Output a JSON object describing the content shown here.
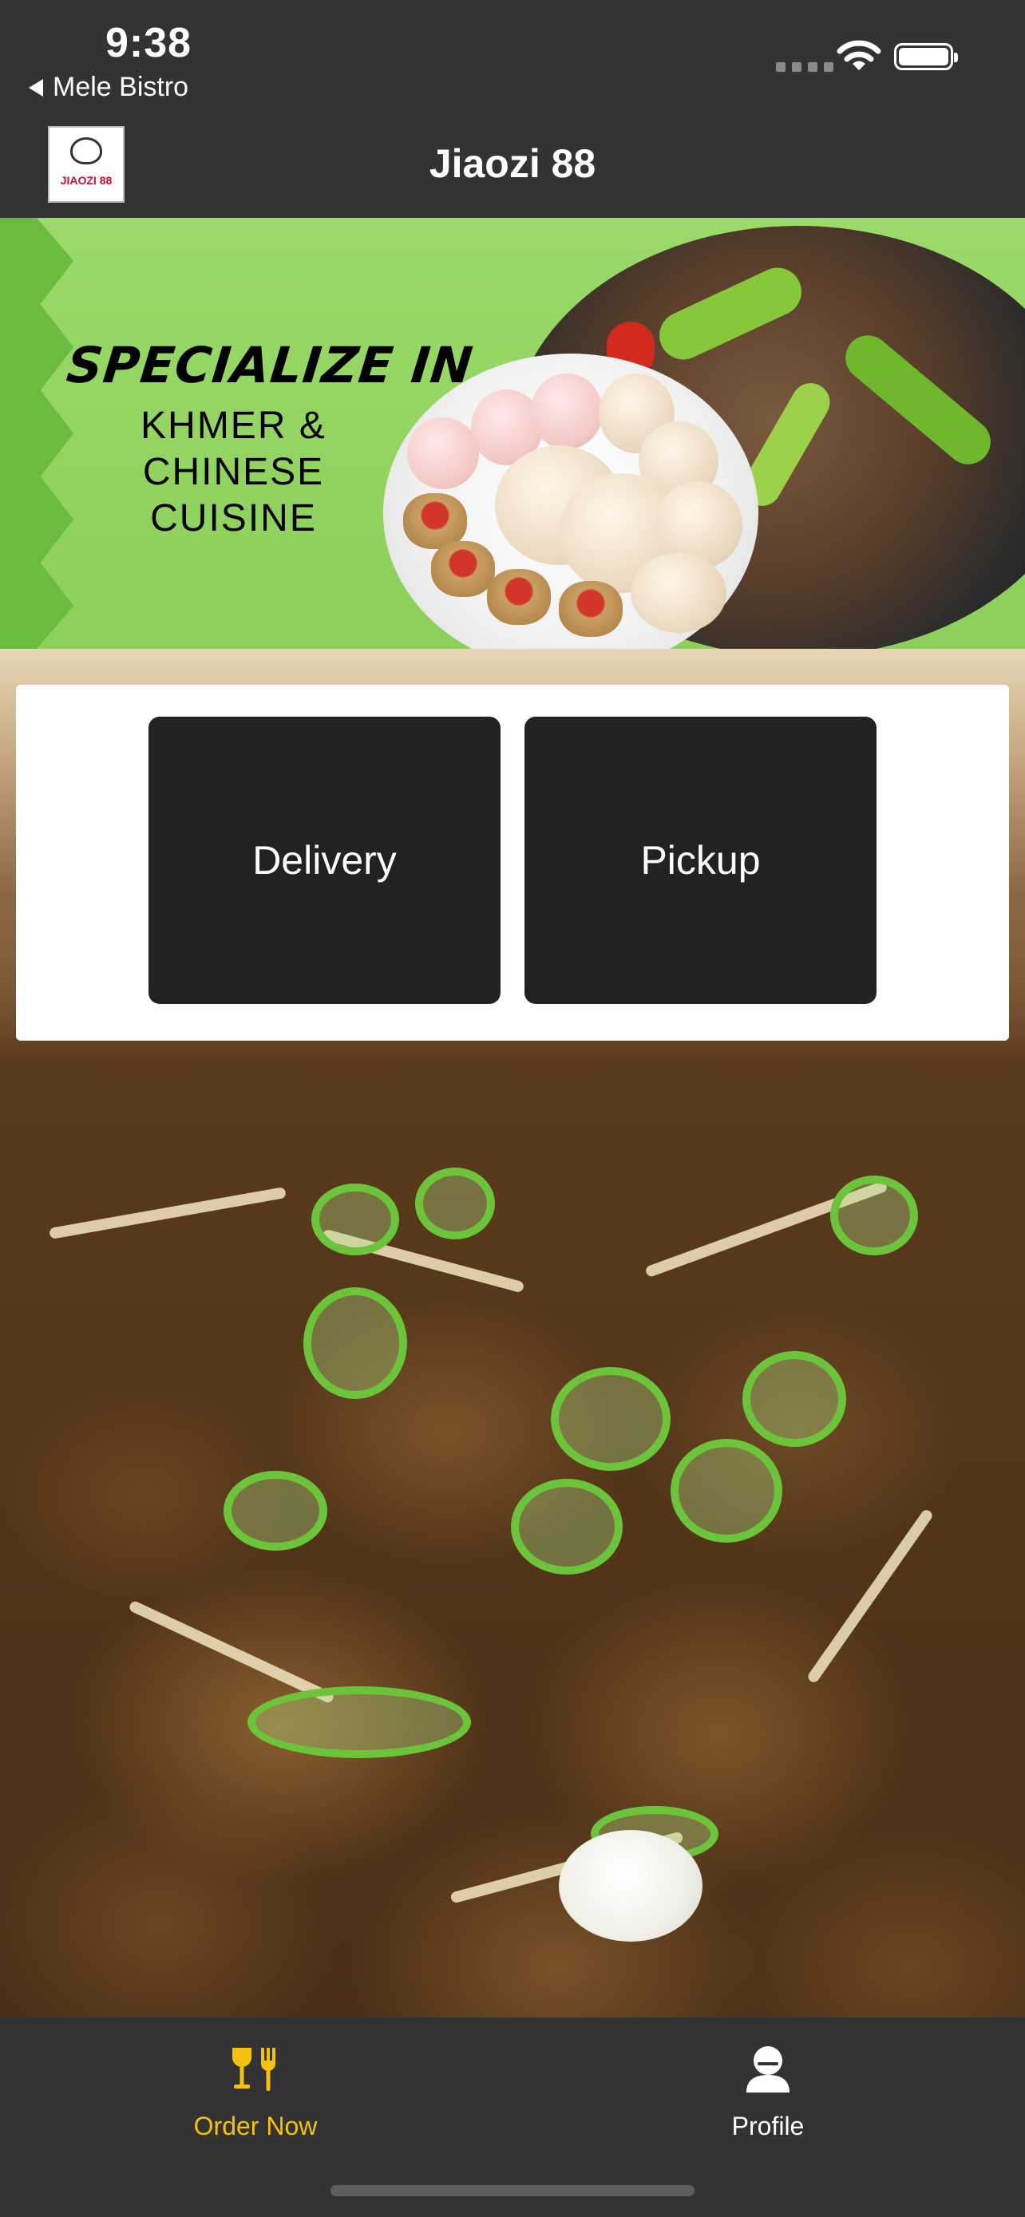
{
  "status_bar": {
    "time": "9:38",
    "back_app": "Mele Bistro"
  },
  "header": {
    "title": "Jiaozi 88",
    "logo_text": "JIAOZI 88"
  },
  "banner": {
    "headline": "SPECIALIZE IN",
    "line1": "KHMER &",
    "line2": "CHINESE",
    "line3": "CUISINE"
  },
  "order_options": {
    "delivery_label": "Delivery",
    "pickup_label": "Pickup"
  },
  "tabbar": {
    "order_label": "Order Now",
    "profile_label": "Profile",
    "active_color": "#f4c20d",
    "inactive_color": "#ffffff",
    "order_icon": "utensils-glasses-icon",
    "profile_icon": "person-icon"
  }
}
